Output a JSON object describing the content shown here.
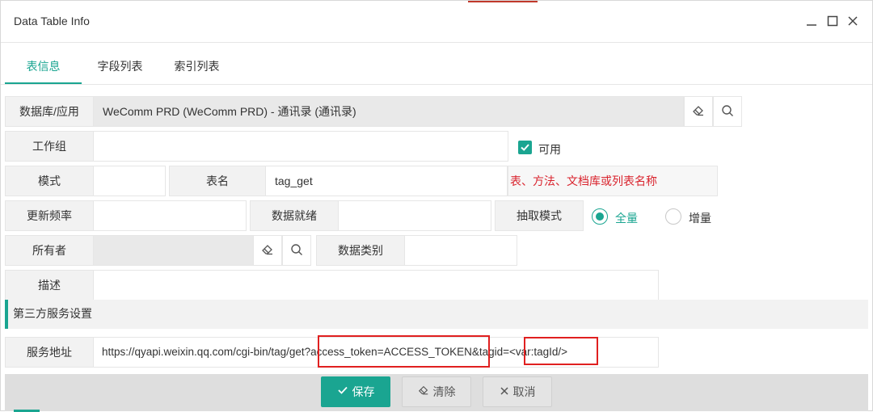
{
  "window": {
    "title": "Data Table Info"
  },
  "tabs": [
    {
      "label": "表信息",
      "active": true
    },
    {
      "label": "字段列表",
      "active": false
    },
    {
      "label": "索引列表",
      "active": false
    }
  ],
  "form": {
    "database_label": "数据库/应用",
    "database_value": "WeComm PRD (WeComm PRD) - 通讯录 (通讯录)",
    "workgroup_label": "工作组",
    "workgroup_value": "",
    "available_label": "可用",
    "available_checked": true,
    "mode_label": "模式",
    "mode_value": "",
    "table_name_label": "表名",
    "table_name_value": "tag_get",
    "table_name_hint": "表、方法、文档库或列表名称",
    "update_freq_label": "更新频率",
    "update_freq_value": "",
    "data_ready_label": "数据就绪",
    "data_ready_value": "",
    "extract_mode_label": "抽取模式",
    "extract_full_label": "全量",
    "extract_incremental_label": "增量",
    "extract_selected": "全量",
    "owner_label": "所有者",
    "owner_value": "",
    "data_category_label": "数据类别",
    "data_category_value": "",
    "description_label": "描述",
    "description_value": ""
  },
  "third_party": {
    "section_title": "第三方服务设置",
    "service_url_label": "服务地址",
    "service_url_value": "https://qyapi.weixin.qq.com/cgi-bin/tag/get?access_token=ACCESS_TOKEN&tagid=<var:tagId/>"
  },
  "footer": {
    "save_label": "保存",
    "clear_label": "清除",
    "cancel_label": "取消"
  },
  "colors": {
    "accent": "#1aa591",
    "hint_red": "#d9232d",
    "highlight_box": "#e02020"
  }
}
